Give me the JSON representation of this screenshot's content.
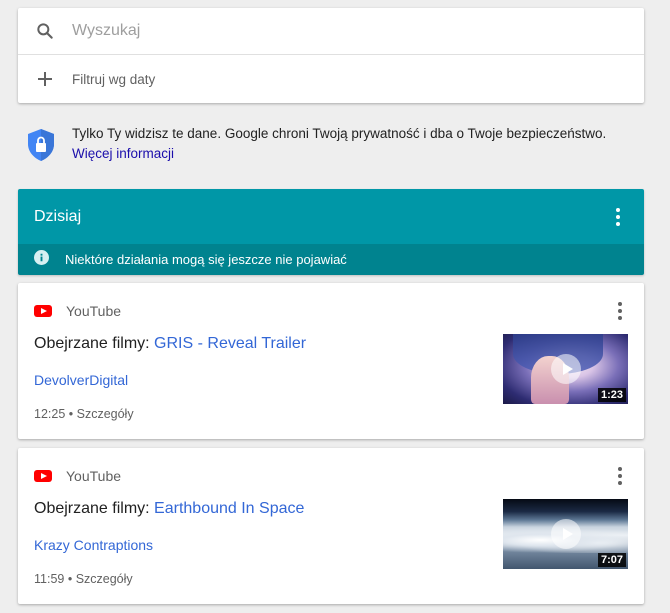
{
  "search": {
    "placeholder": "Wyszukaj",
    "filter_label": "Filtruj wg daty"
  },
  "privacy": {
    "text": "Tylko Ty widzisz te dane. Google chroni Twoją prywatność i dba o Twoje bezpieczeństwo.",
    "link": "Więcej informacji"
  },
  "day": {
    "title": "Dzisiaj",
    "notice": "Niektóre działania mogą się jeszcze nie pojawiać"
  },
  "items": [
    {
      "source": "YouTube",
      "prefix": "Obejrzane filmy: ",
      "video": "GRIS - Reveal Trailer",
      "channel": "DevolverDigital",
      "time": "12:25",
      "sep": " • ",
      "details": "Szczegóły",
      "duration": "1:23"
    },
    {
      "source": "YouTube",
      "prefix": "Obejrzane filmy: ",
      "video": "Earthbound In Space",
      "channel": "Krazy Contraptions",
      "time": "11:59",
      "sep": " • ",
      "details": "Szczegóły",
      "duration": "7:07"
    }
  ],
  "icons": {
    "search": "search-icon",
    "add": "plus-icon",
    "shield": "shield-lock-icon",
    "info": "info-icon",
    "menu": "more-vert-icon",
    "youtube": "youtube-icon"
  },
  "colors": {
    "accent": "#0097a7",
    "accent_dark": "#00838f",
    "link": "#3367d6",
    "youtube": "#ff0000"
  }
}
